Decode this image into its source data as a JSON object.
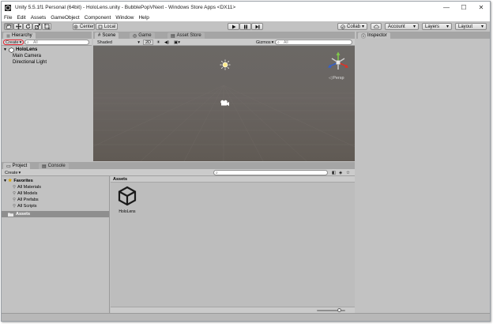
{
  "window": {
    "title": "Unity 5.5.1f1 Personal (64bit) - HoloLens.unity - BubblePopVNext - Windows Store Apps <DX11>",
    "minimize_glyph": "—",
    "maximize_glyph": "☐",
    "close_glyph": "✕"
  },
  "menu": [
    "File",
    "Edit",
    "Assets",
    "GameObject",
    "Component",
    "Window",
    "Help"
  ],
  "toolbar": {
    "pivot_label": "Center",
    "space_label": "Local",
    "collab_label": "Collab",
    "account_label": "Account",
    "layers_label": "Layers",
    "layout_label": "Layout",
    "dropdown_arrow": "▾"
  },
  "hierarchy": {
    "tab_label": "Hierarchy",
    "create_label": "Create",
    "search_placeholder": "All",
    "scene_name": "HoloLens",
    "items": [
      "Main Camera",
      "Directional Light"
    ],
    "highlight_color": "#e0202e"
  },
  "scene": {
    "tabs": [
      "Scene",
      "Game",
      "Asset Store"
    ],
    "shading_mode": "Shaded",
    "mode_2d_label": "2D",
    "gizmos_label": "Gizmos",
    "search_placeholder": "All",
    "persp_label": "Persp",
    "background_color": "#6a6663"
  },
  "inspector": {
    "tab_label": "Inspector"
  },
  "project": {
    "tabs": [
      "Project",
      "Console"
    ],
    "create_label": "Create",
    "favorites_label": "Favorites",
    "favorites": [
      "All Materials",
      "All Models",
      "All Prefabs",
      "All Scripts"
    ],
    "assets_root_label": "Assets",
    "breadcrumb": "Assets",
    "asset_items": [
      {
        "name": "HoloLens",
        "icon": "unity-scene-icon"
      }
    ]
  },
  "colors": {
    "editor_bg": "#c2c2c2",
    "selection": "#8e8e8e",
    "favorite_star": "#d8a300"
  }
}
